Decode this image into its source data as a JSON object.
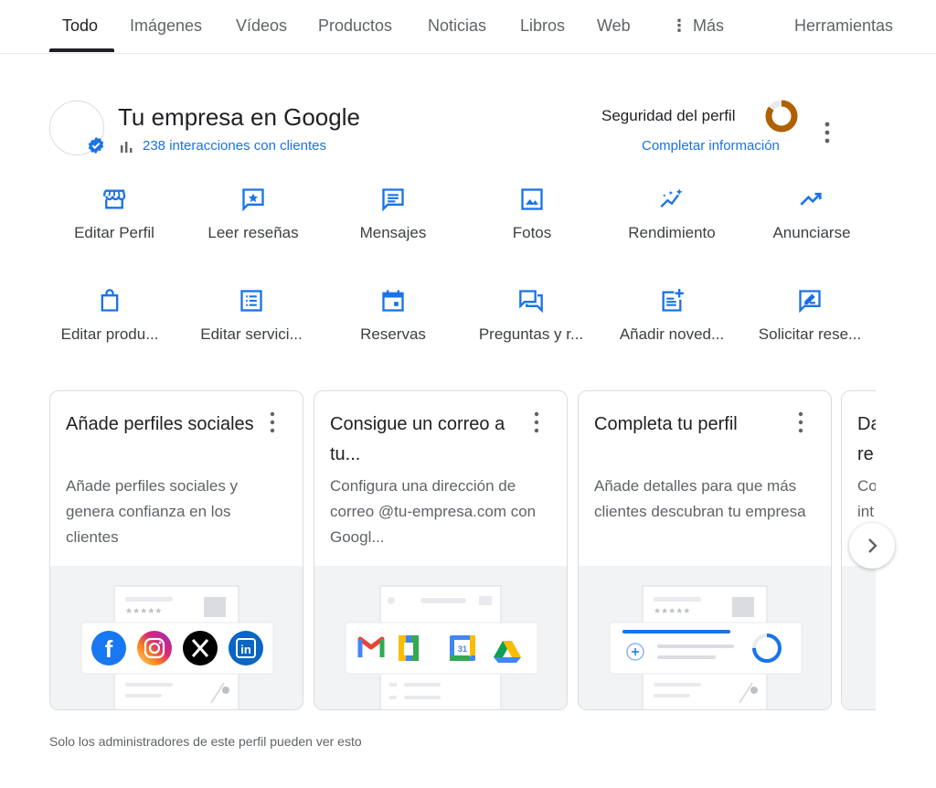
{
  "tabs": [
    {
      "label": "Todo",
      "active": true
    },
    {
      "label": "Imágenes"
    },
    {
      "label": "Vídeos"
    },
    {
      "label": "Productos"
    },
    {
      "label": "Noticias"
    },
    {
      "label": "Libros"
    },
    {
      "label": "Web"
    },
    {
      "label": "Más"
    }
  ],
  "tools_label": "Herramientas",
  "profile": {
    "name": "Tu empresa en Google",
    "interactions": "238 interacciones con clientes",
    "security_label": "Seguridad del perfil",
    "security_progress": 0.85,
    "complete_link": "Completar información"
  },
  "actions_row1": [
    {
      "label": "Editar Perfil",
      "icon": "storefront-icon"
    },
    {
      "label": "Leer reseñas",
      "icon": "star-review-icon"
    },
    {
      "label": "Mensajes",
      "icon": "message-icon"
    },
    {
      "label": "Fotos",
      "icon": "photo-icon"
    },
    {
      "label": "Rendimiento",
      "icon": "performance-icon"
    },
    {
      "label": "Anunciarse",
      "icon": "trending-icon"
    }
  ],
  "actions_row2": [
    {
      "label": "Editar produ...",
      "icon": "shopping-bag-icon"
    },
    {
      "label": "Editar servici...",
      "icon": "list-icon"
    },
    {
      "label": "Reservas",
      "icon": "calendar-icon"
    },
    {
      "label": "Preguntas y r...",
      "icon": "forum-icon"
    },
    {
      "label": "Añadir noved...",
      "icon": "post-add-icon"
    },
    {
      "label": "Solicitar rese...",
      "icon": "rate-review-icon"
    }
  ],
  "cards": [
    {
      "title": "Añade perfiles sociales",
      "desc": "Añade perfiles sociales y genera confianza en los clientes"
    },
    {
      "title": "Consigue un correo a tu...",
      "desc": "Configura una dirección de correo @tu-empresa.com con Googl..."
    },
    {
      "title": "Completa tu perfil",
      "desc": "Añade detalles para que más clientes descubran tu empresa"
    },
    {
      "title": "Da re",
      "desc": "Co int"
    }
  ],
  "calendar_day": "31",
  "footer": "Solo los administradores de este perfil pueden ver esto",
  "colors": {
    "accent": "#1a73e8",
    "security_ring": "#b06000",
    "facebook": "#1877f2",
    "linkedin": "#0a66c2"
  }
}
